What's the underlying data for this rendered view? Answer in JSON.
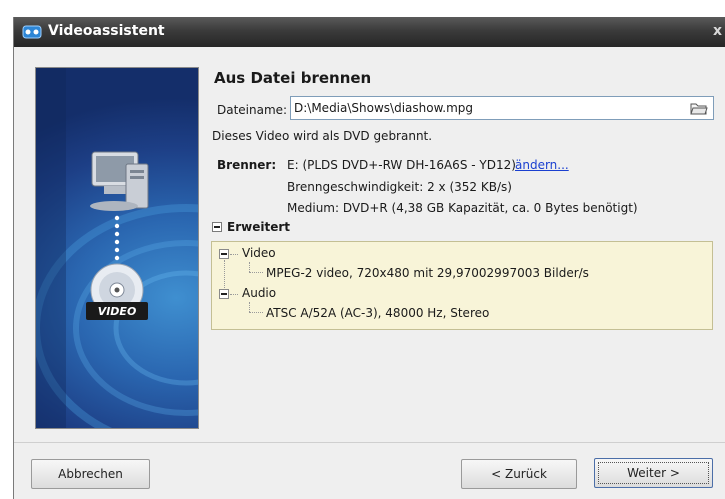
{
  "window": {
    "title": "Videoassistent",
    "close_glyph": "x"
  },
  "side_panel": {
    "badge_text": "VIDEO",
    "icons": [
      "computer-icon",
      "dvd-disc-icon"
    ]
  },
  "content": {
    "title": "Aus Datei brennen",
    "file": {
      "label": "Dateiname:",
      "value": "D:\\Media\\Shows\\diashow.mpg"
    },
    "info": "Dieses Video wird als DVD gebrannt."
  },
  "burner": {
    "label": "Brenner:",
    "device": "E: (PLDS DVD+-RW DH-16A6S - YD12)",
    "change_link": "ändern...",
    "speed": "Brenngeschwindigkeit: 2 x (352 KB/s)",
    "medium": "Medium: DVD+R (4,38 GB Kapazität, ca. 0 Bytes benötigt)"
  },
  "advanced": {
    "label": "Erweitert",
    "tree": {
      "video_label": "Video",
      "video_detail": "MPEG-2 video, 720x480 mit 29,97002997003 Bilder/s",
      "audio_label": "Audio",
      "audio_detail": "ATSC A/52A (AC-3), 48000 Hz, Stereo"
    }
  },
  "buttons": {
    "cancel": "Abbrechen",
    "back": "< Zurück",
    "next": "Weiter >"
  },
  "colors": {
    "titlebar": "#2f2f2f",
    "link": "#1a3fd0",
    "tree_bg": "#f8f4d8",
    "side_panel": "#1d3f86"
  }
}
